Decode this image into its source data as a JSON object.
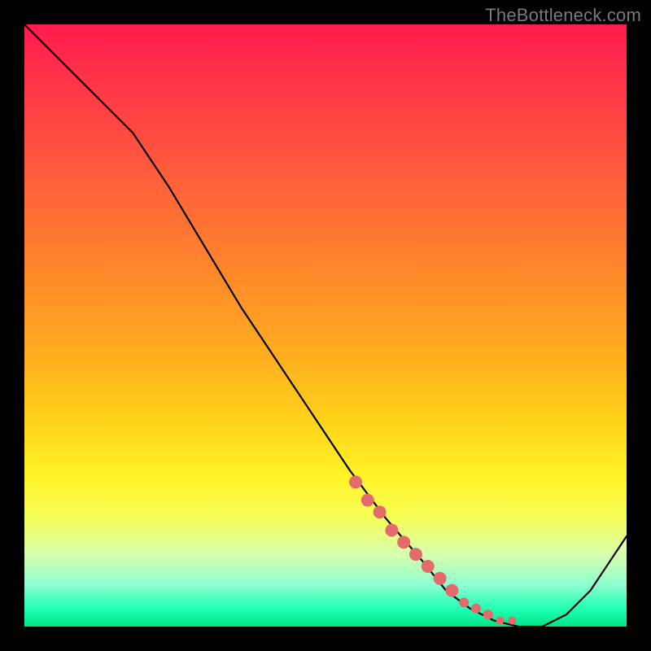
{
  "attribution": "TheBottleneck.com",
  "chart_data": {
    "type": "line",
    "title": "",
    "xlabel": "",
    "ylabel": "",
    "xlim": [
      0,
      100
    ],
    "ylim": [
      0,
      100
    ],
    "grid": false,
    "legend": false,
    "series": [
      {
        "name": "curve",
        "x": [
          0,
          6,
          12,
          18,
          24,
          30,
          36,
          42,
          48,
          54,
          60,
          66,
          70,
          74,
          78,
          82,
          86,
          90,
          94,
          98,
          100
        ],
        "values": [
          100,
          94,
          88,
          82,
          73,
          63,
          53,
          44,
          35,
          26,
          18,
          11,
          6,
          3,
          1,
          0,
          0,
          2,
          6,
          12,
          15
        ]
      }
    ],
    "highlight": {
      "name": "red-dots",
      "x": [
        55,
        57,
        59,
        61,
        63,
        65,
        67,
        69,
        71,
        73,
        75,
        77,
        79,
        81
      ],
      "values": [
        24,
        21,
        19,
        16,
        14,
        12,
        10,
        8,
        6,
        4,
        3,
        2,
        1,
        1
      ]
    }
  },
  "colors": {
    "curve": "#000000",
    "dots": "#e36b6b",
    "dotsStroke": "#c94a4a"
  }
}
